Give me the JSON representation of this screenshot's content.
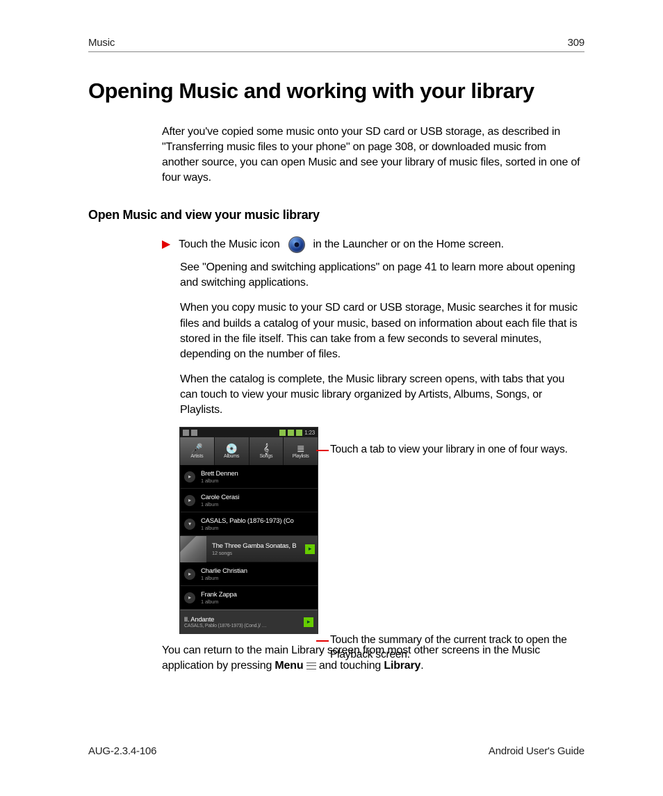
{
  "header": {
    "section": "Music",
    "page_number": "309"
  },
  "title": "Opening Music and working with your library",
  "intro": "After you've copied some music onto your SD card or USB storage, as described in \"Transferring music files to your phone\" on page 308, or downloaded music from another source, you can open Music and see your library of music files, sorted in one of four ways.",
  "subheading": "Open Music and view your music library",
  "bullet_line": {
    "pre": "Touch the Music icon",
    "post": "in the Launcher or on the Home screen."
  },
  "paras": {
    "p1": "See \"Opening and switching applications\" on page 41 to learn more about opening and switching applications.",
    "p2": "When you copy music to your SD card or USB storage, Music searches it for music files and builds a catalog of your music, based on information about each file that is stored in the file itself. This can take from a few seconds to several minutes, depending on the number of files.",
    "p3": "When the catalog is complete, the Music library screen opens, with tabs that you can touch to view your music library organized by Artists, Albums, Songs, or Playlists."
  },
  "phone": {
    "clock": "1:23",
    "tabs": [
      {
        "label": "Artists",
        "glyph": "🎤"
      },
      {
        "label": "Albums",
        "glyph": "💿"
      },
      {
        "label": "Songs",
        "glyph": "𝄞"
      },
      {
        "label": "Playlists",
        "glyph": "≣"
      }
    ],
    "artists": [
      {
        "name": "Brett Dennen",
        "sub": "1 album"
      },
      {
        "name": "Carole Cerasi",
        "sub": "1 album"
      },
      {
        "name": "CASALS, Pablo (1876-1973) (Co",
        "sub": "1 album",
        "expanded": true
      }
    ],
    "album": {
      "title": "The Three Gamba Sonatas, B",
      "sub": "12 songs"
    },
    "artists2": [
      {
        "name": "Charlie Christian",
        "sub": "1 album"
      },
      {
        "name": "Frank Zappa",
        "sub": "1 album"
      }
    ],
    "nowplaying": {
      "title": "II. Andante",
      "sub": "CASALS, Pablo (1876-1973) (Cond.)/ …"
    }
  },
  "callouts": {
    "tabs": "Touch a tab to view your library in one of four ways.",
    "nowplaying": "Touch the summary of the current track to open the Playback screen."
  },
  "closing": {
    "pre": "You can return to the main Library screen from most other screens in the Music application by pressing ",
    "menu_word": "Menu",
    "mid": " and touching ",
    "library_word": "Library",
    "post": "."
  },
  "footer": {
    "left": "AUG-2.3.4-106",
    "right": "Android User's Guide"
  }
}
